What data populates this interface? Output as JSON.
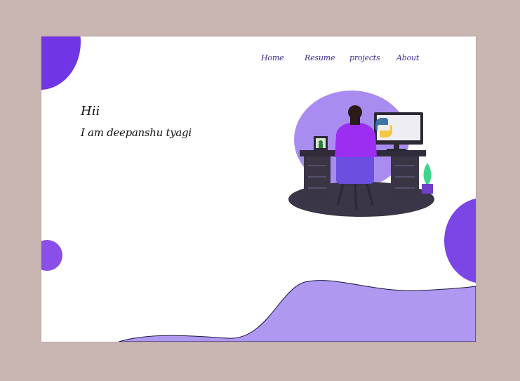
{
  "nav": {
    "items": [
      {
        "label": "Home"
      },
      {
        "label": "Resume"
      },
      {
        "label": "projects"
      },
      {
        "label": "About"
      }
    ]
  },
  "hero": {
    "greeting": "Hii",
    "intro": "I am deepanshu tyagi"
  },
  "colors": {
    "background": "#c9b5b2",
    "accent": "#7035e4",
    "wave": "#af98f0",
    "nav_text": "#3a2a8c"
  }
}
